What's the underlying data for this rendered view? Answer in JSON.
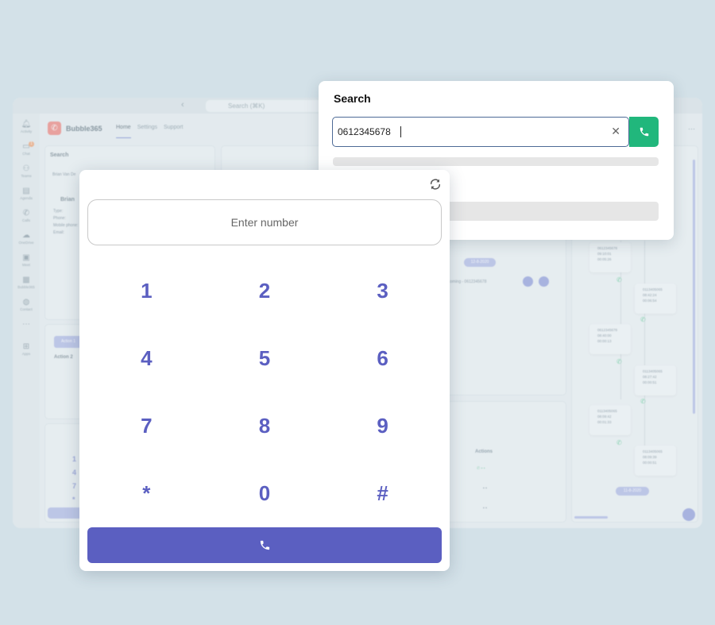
{
  "background": {
    "search_bar": "Search (⌘K)",
    "brand": "Bubble365",
    "nav": [
      "Home",
      "Settings",
      "Support"
    ],
    "sidebar": [
      {
        "icon": "bell-icon",
        "label": "Activity"
      },
      {
        "icon": "chat-icon",
        "label": "Chat",
        "badge": "1"
      },
      {
        "icon": "teams-icon",
        "label": "Teams"
      },
      {
        "icon": "calendar-icon",
        "label": "Agenda"
      },
      {
        "icon": "phone-icon",
        "label": "Calls"
      },
      {
        "icon": "cloud-icon",
        "label": "OneDrive"
      },
      {
        "icon": "video-icon",
        "label": "Meet"
      },
      {
        "icon": "bubble-icon",
        "label": "Bubble365"
      },
      {
        "icon": "contacts-icon",
        "label": "Contact"
      },
      {
        "icon": "more-icon",
        "label": ""
      },
      {
        "icon": "apps-icon",
        "label": "Apps"
      }
    ],
    "search_label": "Search",
    "search_value": "Brian Van De",
    "contact_name": "Brian",
    "contact_fields": [
      "Type:",
      "Phone:",
      "Mobile phone:",
      "Email:"
    ],
    "action1": "Action 1",
    "action2": "Action 2",
    "date_pill_1": "12-8-2020",
    "call_row": "coming - 0612345678",
    "actions_header": "Actions",
    "date_pill_2": "11-8-2020",
    "mini_keys": [
      "1",
      "4",
      "7",
      "*"
    ],
    "timeline_cards": [
      {
        "number": "0612345678",
        "time": "09:10:01",
        "duration": "00:05:26"
      },
      {
        "number": "0113405065",
        "time": "08:42:24",
        "duration": "00:06:54"
      },
      {
        "number": "0612345678",
        "time": "08:40:00",
        "duration": "00:00:13"
      },
      {
        "number": "0113405065",
        "time": "08:27:42",
        "duration": "00:00:51"
      },
      {
        "number": "0113405065",
        "time": "08:09:42",
        "duration": "00:01:33"
      },
      {
        "number": "0113405065",
        "time": "08:09:39",
        "duration": "00:00:51"
      }
    ]
  },
  "search_popup": {
    "title": "Search",
    "input_value": "0612345678",
    "clear_icon": "close-icon",
    "call_icon": "phone-icon",
    "call_color": "#21b77c"
  },
  "dialer": {
    "refresh_icon": "refresh-icon",
    "placeholder": "Enter number",
    "keys": [
      "1",
      "2",
      "3",
      "4",
      "5",
      "6",
      "7",
      "8",
      "9",
      "*",
      "0",
      "#"
    ],
    "call_icon": "phone-icon",
    "accent": "#5b5fc1"
  }
}
